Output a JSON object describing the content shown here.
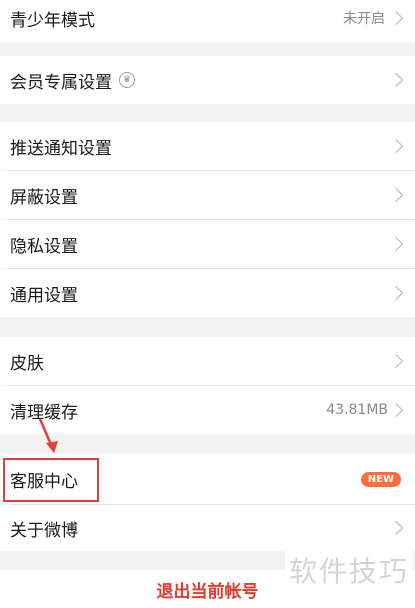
{
  "rows": {
    "teen_mode": {
      "label": "青少年模式",
      "value": "未开启"
    },
    "vip_settings": {
      "label": "会员专属设置"
    },
    "push_settings": {
      "label": "推送通知设置"
    },
    "block_settings": {
      "label": "屏蔽设置"
    },
    "privacy_settings": {
      "label": "隐私设置"
    },
    "general_settings": {
      "label": "通用设置"
    },
    "skin": {
      "label": "皮肤"
    },
    "clear_cache": {
      "label": "清理缓存",
      "value": "43.81MB"
    },
    "customer_service": {
      "label": "客服中心",
      "badge": "NEW"
    },
    "about": {
      "label": "关于微博"
    }
  },
  "logout": {
    "label": "退出当前帐号"
  },
  "watermark": {
    "text": "软件技巧"
  },
  "colors": {
    "accent_red": "#e23b2e",
    "badge_orange": "#ff6e3a",
    "annotation_red": "#e0413b"
  }
}
